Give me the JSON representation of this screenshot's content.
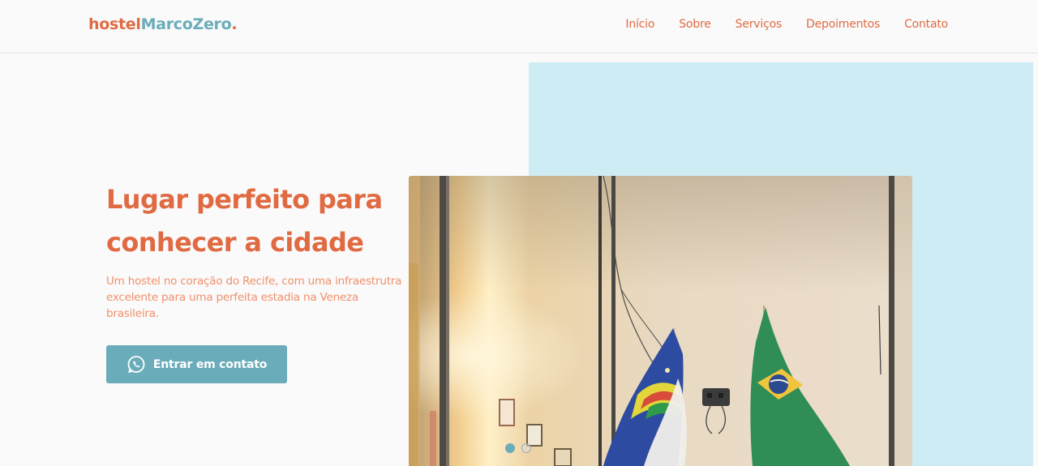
{
  "brand": {
    "part1": "hostel",
    "part2": "MarcoZero",
    "part3": "."
  },
  "nav": {
    "items": [
      {
        "label": "Início"
      },
      {
        "label": "Sobre"
      },
      {
        "label": "Serviços"
      },
      {
        "label": "Depoimentos"
      },
      {
        "label": "Contato"
      }
    ]
  },
  "hero": {
    "title": "Lugar perfeito para conhecer a cidade",
    "subtitle": "Um hostel no coração do Recife, com uma infraestrutra excelente para uma perfeita estadia na Veneza brasileira.",
    "cta_label": "Entrar em contato",
    "cta_icon": "whatsapp-icon"
  },
  "carousel": {
    "slide_count": 2,
    "active_index": 0
  },
  "colors": {
    "accent_orange": "#e06a42",
    "accent_teal": "#6aacba",
    "hero_panel": "#ceecf4",
    "subtitle": "#f08f6b"
  }
}
